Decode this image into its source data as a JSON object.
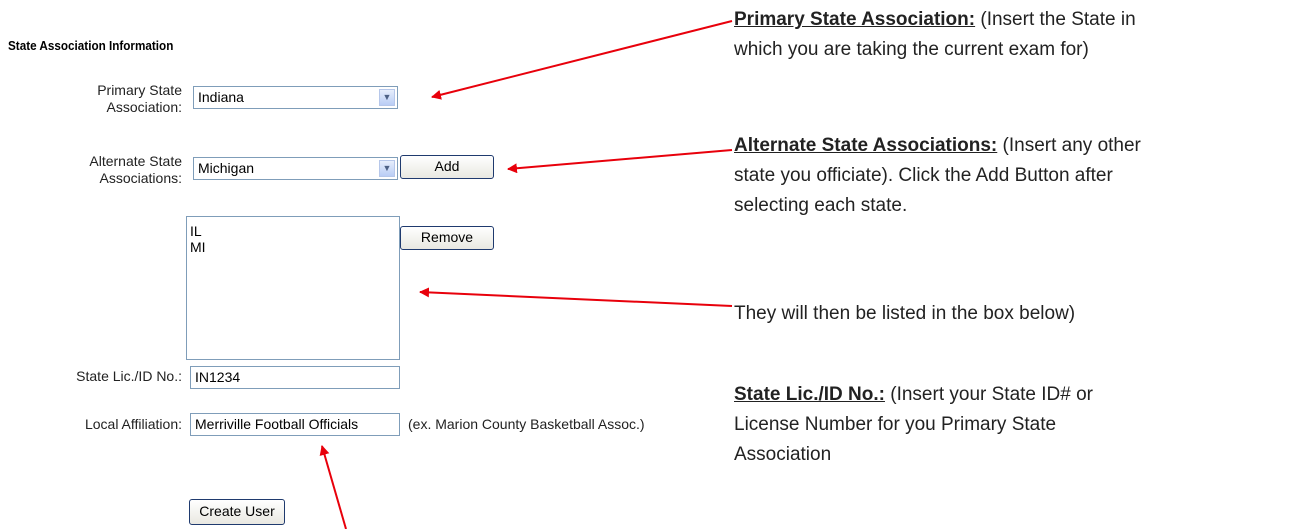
{
  "form": {
    "title": "State Association Information",
    "primary_label_1": "Primary State",
    "primary_label_2": "Association:",
    "primary_value": "Indiana",
    "alternate_label_1": "Alternate State",
    "alternate_label_2": "Associations:",
    "alternate_value": "Michigan",
    "add_label": "Add",
    "remove_label": "Remove",
    "list_items": [
      "IL",
      "MI"
    ],
    "lic_label": "State Lic./ID No.:",
    "lic_value": "IN1234",
    "affil_label": "Local Affiliation:",
    "affil_value": "Merriville Football Officials",
    "affil_hint": "(ex. Marion County Basketball Assoc.)",
    "create_label": "Create User"
  },
  "annotations": {
    "primary_heading": "Primary State Association:",
    "primary_text_1": " (Insert the State in",
    "primary_text_2": "which you are taking the current exam for)",
    "alternate_heading": "Alternate State Associations:",
    "alternate_text_1": " (Insert any other",
    "alternate_text_2": "state you officiate).  Click the Add Button after",
    "alternate_text_3": "selecting each state.",
    "list_text": "They will then be listed in the box below)",
    "lic_heading": "State Lic./ID No.:",
    "lic_text_1": " (Insert your State ID# or",
    "lic_text_2": "License Number for you Primary State",
    "lic_text_3": "Association"
  },
  "colors": {
    "arrow": "#e8000b",
    "input_border": "#7f9db9",
    "button_border": "#1f3a6e"
  },
  "icons": {
    "dropdown": "chevron-down-icon"
  }
}
